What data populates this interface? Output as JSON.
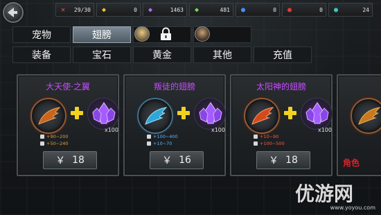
{
  "topbar": {
    "resources": [
      {
        "icon": "energy-icon",
        "value": "29/30"
      },
      {
        "icon": "gold-icon",
        "value": "0"
      },
      {
        "icon": "purple-crystal-icon",
        "value": "1463"
      },
      {
        "icon": "green-crystal-icon",
        "value": "481"
      },
      {
        "icon": "blue-potion-icon",
        "value": "0"
      },
      {
        "icon": "red-potion-icon",
        "value": "0"
      },
      {
        "icon": "teal-drop-icon",
        "value": "24"
      }
    ]
  },
  "tabs_row1": [
    {
      "label": "宠物"
    },
    {
      "label": "翅膀"
    }
  ],
  "tabs_row2": [
    {
      "label": "装备"
    },
    {
      "label": "宝石"
    },
    {
      "label": "黄金"
    },
    {
      "label": "其他"
    },
    {
      "label": "充值"
    }
  ],
  "cards": [
    {
      "title": "大天使·之翼",
      "item_qty": "x100",
      "atk": "+90~200",
      "def": "+50~240",
      "currency": "￥",
      "price": "18",
      "color": "#c9651e"
    },
    {
      "title": "叛徒的翅膀",
      "item_qty": "x100",
      "atk": "+100~400",
      "def": "+10~70",
      "currency": "￥",
      "price": "16",
      "color": "#2ea6d8"
    },
    {
      "title": "太阳神的翅膀",
      "item_qty": "x100",
      "atk": "+10~90",
      "def": "+100~500",
      "currency": "￥",
      "price": "18",
      "color": "#d24a1c"
    }
  ],
  "partial_card_label": "角色",
  "watermark": {
    "big": "优游网",
    "small": "www.yoyou.com"
  }
}
